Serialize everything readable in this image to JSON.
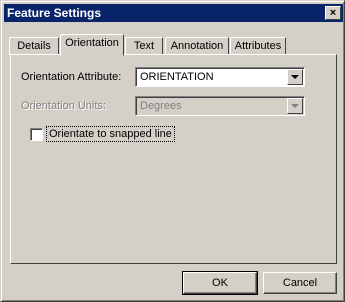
{
  "window": {
    "title": "Feature Settings",
    "close_glyph": "×"
  },
  "tabs": [
    {
      "label": "Details"
    },
    {
      "label": "Orientation",
      "active": true
    },
    {
      "label": "Text"
    },
    {
      "label": "Annotation"
    },
    {
      "label": "Attributes"
    }
  ],
  "orientation": {
    "attribute_label": "Orientation Attribute:",
    "attribute_value": "ORIENTATION",
    "units_label": "Orientation Units:",
    "units_value": "Degrees",
    "snap_label": "Orientate to snapped line",
    "snap_checked": false
  },
  "buttons": {
    "ok": "OK",
    "cancel": "Cancel"
  }
}
